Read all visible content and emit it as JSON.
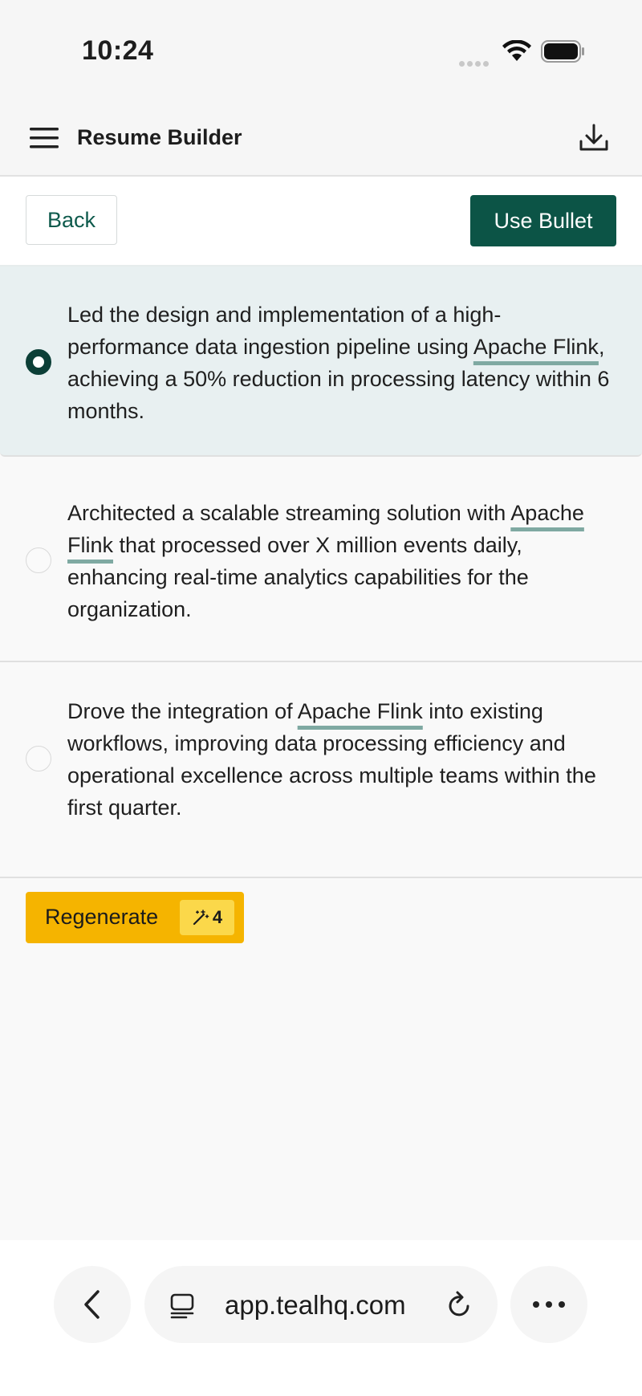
{
  "status": {
    "time": "10:24"
  },
  "app": {
    "title": "Resume Builder"
  },
  "actions": {
    "back_label": "Back",
    "use_label": "Use Bullet"
  },
  "options": [
    {
      "selected": true,
      "parts": [
        {
          "text": "Led the design and implementation of a high-performance data ingestion pipeline using ",
          "kw": false
        },
        {
          "text": "Apache Flink",
          "kw": true
        },
        {
          "text": ", achieving a 50% reduction in processing latency within 6 months.",
          "kw": false
        }
      ]
    },
    {
      "selected": false,
      "parts": [
        {
          "text": "Architected a scalable streaming solution with ",
          "kw": false
        },
        {
          "text": "Apache Flink",
          "kw": true
        },
        {
          "text": " that processed over X million events daily, enhancing real-time analytics capabilities for the organization.",
          "kw": false
        }
      ]
    },
    {
      "selected": false,
      "parts": [
        {
          "text": "Drove the integration of ",
          "kw": false
        },
        {
          "text": "Apache Flink",
          "kw": true
        },
        {
          "text": " into existing workflows, improving data processing efficiency and operational excellence across multiple teams within the first quarter.",
          "kw": false
        }
      ]
    }
  ],
  "regenerate": {
    "label": "Regenerate",
    "credits": "4"
  },
  "browser": {
    "url": "app.tealhq.com"
  },
  "icons": {
    "menu": "hamburger-icon",
    "download": "download-icon",
    "magic": "magic-wand-icon",
    "back": "chevron-left-icon",
    "tabs": "tabs-icon",
    "reload": "reload-icon",
    "more": "more-icon"
  },
  "colors": {
    "primary": "#0c5446",
    "selected_bg": "#e8f0f1",
    "keyword_underline": "#7fa9a2",
    "regenerate": "#f5b400",
    "badge": "#fbd84a"
  }
}
